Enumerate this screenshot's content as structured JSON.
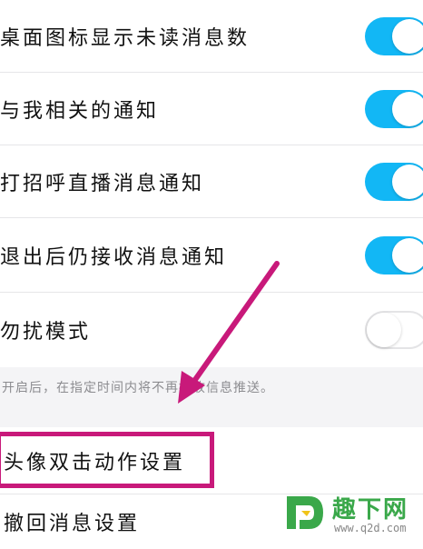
{
  "settings": {
    "badge_count": {
      "label": "桌面图标显示未读消息数",
      "toggle": "on"
    },
    "related_notify": {
      "label": "与我相关的通知",
      "toggle": "on"
    },
    "live_notify": {
      "label": "打招呼直播消息通知",
      "toggle": "on"
    },
    "receive_after_exit": {
      "label": "退出后仍接收消息通知",
      "toggle": "on"
    },
    "do_not_disturb": {
      "label": "勿扰模式",
      "toggle": "off"
    },
    "dnd_hint": "开启后，在指定时间内将不再接收信息推送。",
    "avatar_double_tap": {
      "label": "头像双击动作设置"
    },
    "recall_message": {
      "label": "撤回消息设置"
    }
  },
  "colors": {
    "toggle_on": "#12b7f5",
    "toggle_off": "#ffffff",
    "annotation": "#c8197a",
    "watermark_green": "#3aa84a"
  },
  "watermark": {
    "brand": "趣下网",
    "site": "www.q2d.com"
  },
  "annotations": {
    "arrow_icon": "arrow-down-left",
    "highlight_target": "avatar_double_tap"
  }
}
